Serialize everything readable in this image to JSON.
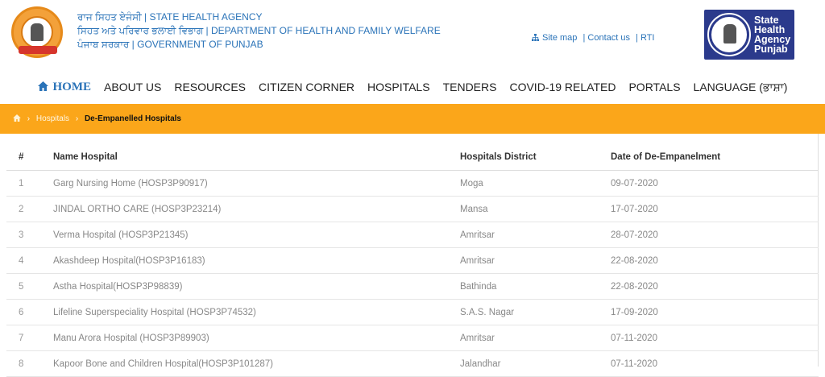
{
  "header": {
    "title_lines": [
      "ਰਾਜ ਸਿਹਤ ਏਜੰਸੀ | STATE HEALTH AGENCY",
      "ਸਿਹਤ ਅਤੇ ਪਰਿਵਾਰ ਭਲਾਈ ਵਿਭਾਗ | DEPARTMENT OF HEALTH AND FAMILY WELFARE",
      "ਪੰਜਾਬ ਸਰਕਾਰ | GOVERNMENT OF PUNJAB"
    ],
    "links": {
      "sitemap": "Site map",
      "contact": "| Contact us",
      "rti": "| RTI"
    },
    "right_logo_text": [
      "State",
      "Health",
      "Agency",
      "Punjab"
    ]
  },
  "nav": {
    "items": [
      "HOME",
      "ABOUT US",
      "RESOURCES",
      "CITIZEN CORNER",
      "HOSPITALS",
      "TENDERS",
      "COVID-19 RELATED",
      "PORTALS",
      "LANGUAGE (ਭਾਸ਼ਾ)"
    ]
  },
  "breadcrumb": {
    "sep": "›",
    "hospitals": "Hospitals",
    "current": "De-Empanelled Hospitals"
  },
  "table": {
    "headers": [
      "#",
      "Name Hospital",
      "Hospitals District",
      "Date of De-Empanelment"
    ],
    "rows": [
      [
        "1",
        "Garg Nursing Home (HOSP3P90917)",
        "Moga",
        "09-07-2020"
      ],
      [
        "2",
        "JINDAL ORTHO CARE (HOSP3P23214)",
        "Mansa",
        "17-07-2020"
      ],
      [
        "3",
        "Verma Hospital (HOSP3P21345)",
        "Amritsar",
        "28-07-2020"
      ],
      [
        "4",
        "Akashdeep Hospital(HOSP3P16183)",
        "Amritsar",
        "22-08-2020"
      ],
      [
        "5",
        "Astha Hospital(HOSP3P98839)",
        "Bathinda",
        "22-08-2020"
      ],
      [
        "6",
        "Lifeline Superspeciality Hospital (HOSP3P74532)",
        "S.A.S. Nagar",
        "17-09-2020"
      ],
      [
        "7",
        "Manu Arora Hospital (HOSP3P89903)",
        "Amritsar",
        "07-11-2020"
      ],
      [
        "8",
        "Kapoor Bone and Children Hospital(HOSP3P101287)",
        "Jalandhar",
        "07-11-2020"
      ]
    ]
  }
}
